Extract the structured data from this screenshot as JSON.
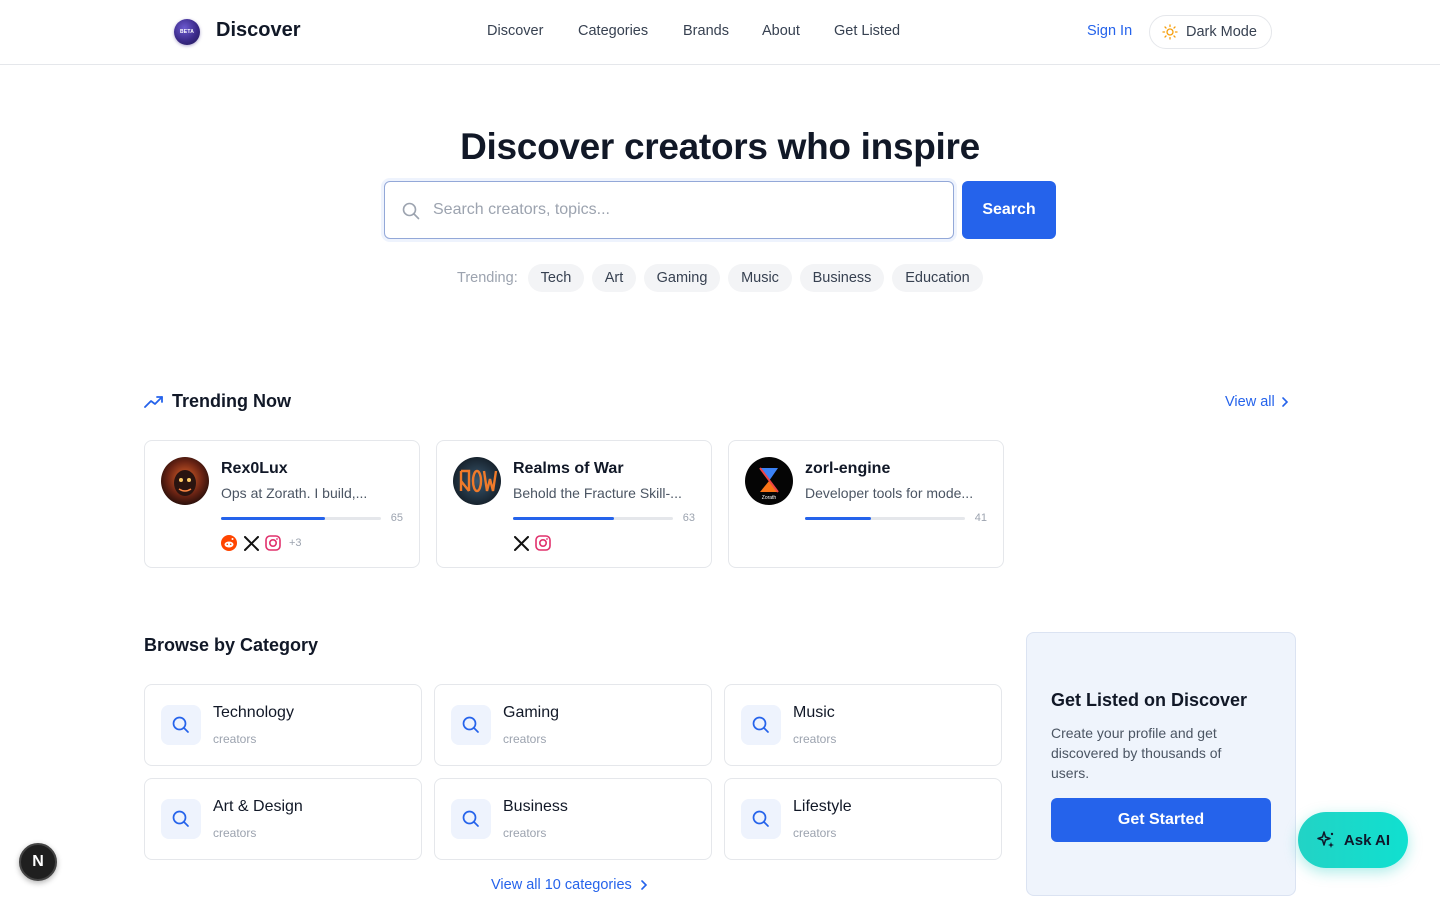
{
  "header": {
    "logo_badge": "BETA",
    "logo_text": "Discover",
    "nav": [
      "Discover",
      "Categories",
      "Brands",
      "About",
      "Get Listed"
    ],
    "sign_in": "Sign In",
    "dark_mode": "Dark Mode"
  },
  "hero": {
    "title": "Discover creators who inspire",
    "search_placeholder": "Search creators, topics...",
    "search_value": "",
    "search_button": "Search",
    "trending_label": "Trending:",
    "trending_chips": [
      "Tech",
      "Art",
      "Gaming",
      "Music",
      "Business",
      "Education"
    ]
  },
  "trending_now": {
    "title": "Trending Now",
    "view_all": "View all",
    "cards": [
      {
        "name": "Rex0Lux",
        "description": "Ops at Zorath. I build,...",
        "score": "65",
        "progress": 0.65,
        "socials": [
          "reddit-icon",
          "x-icon",
          "instagram-icon"
        ],
        "more": "+3"
      },
      {
        "name": "Realms of War",
        "description": "Behold the Fracture Skill-...",
        "score": "63",
        "progress": 0.63,
        "socials": [
          "x-icon",
          "instagram-icon"
        ],
        "more": ""
      },
      {
        "name": "zorl-engine",
        "description": "Developer tools for mode...",
        "score": "41",
        "progress": 0.41,
        "socials": [],
        "more": "",
        "avatar_text": "Zorath"
      }
    ]
  },
  "browse": {
    "title": "Browse by Category",
    "categories": [
      {
        "name": "Technology",
        "sub": "creators"
      },
      {
        "name": "Gaming",
        "sub": "creators"
      },
      {
        "name": "Music",
        "sub": "creators"
      },
      {
        "name": "Art & Design",
        "sub": "creators"
      },
      {
        "name": "Business",
        "sub": "creators"
      },
      {
        "name": "Lifestyle",
        "sub": "creators"
      }
    ],
    "view_all": "View all 10 categories"
  },
  "get_listed": {
    "title": "Get Listed on Discover",
    "text": "Create your profile and get discovered by thousands of users.",
    "button": "Get Started"
  },
  "ask_ai": "Ask AI",
  "dev_badge": "N",
  "colors": {
    "accent": "#2563eb",
    "ask_ai": "#1ed8c9"
  }
}
